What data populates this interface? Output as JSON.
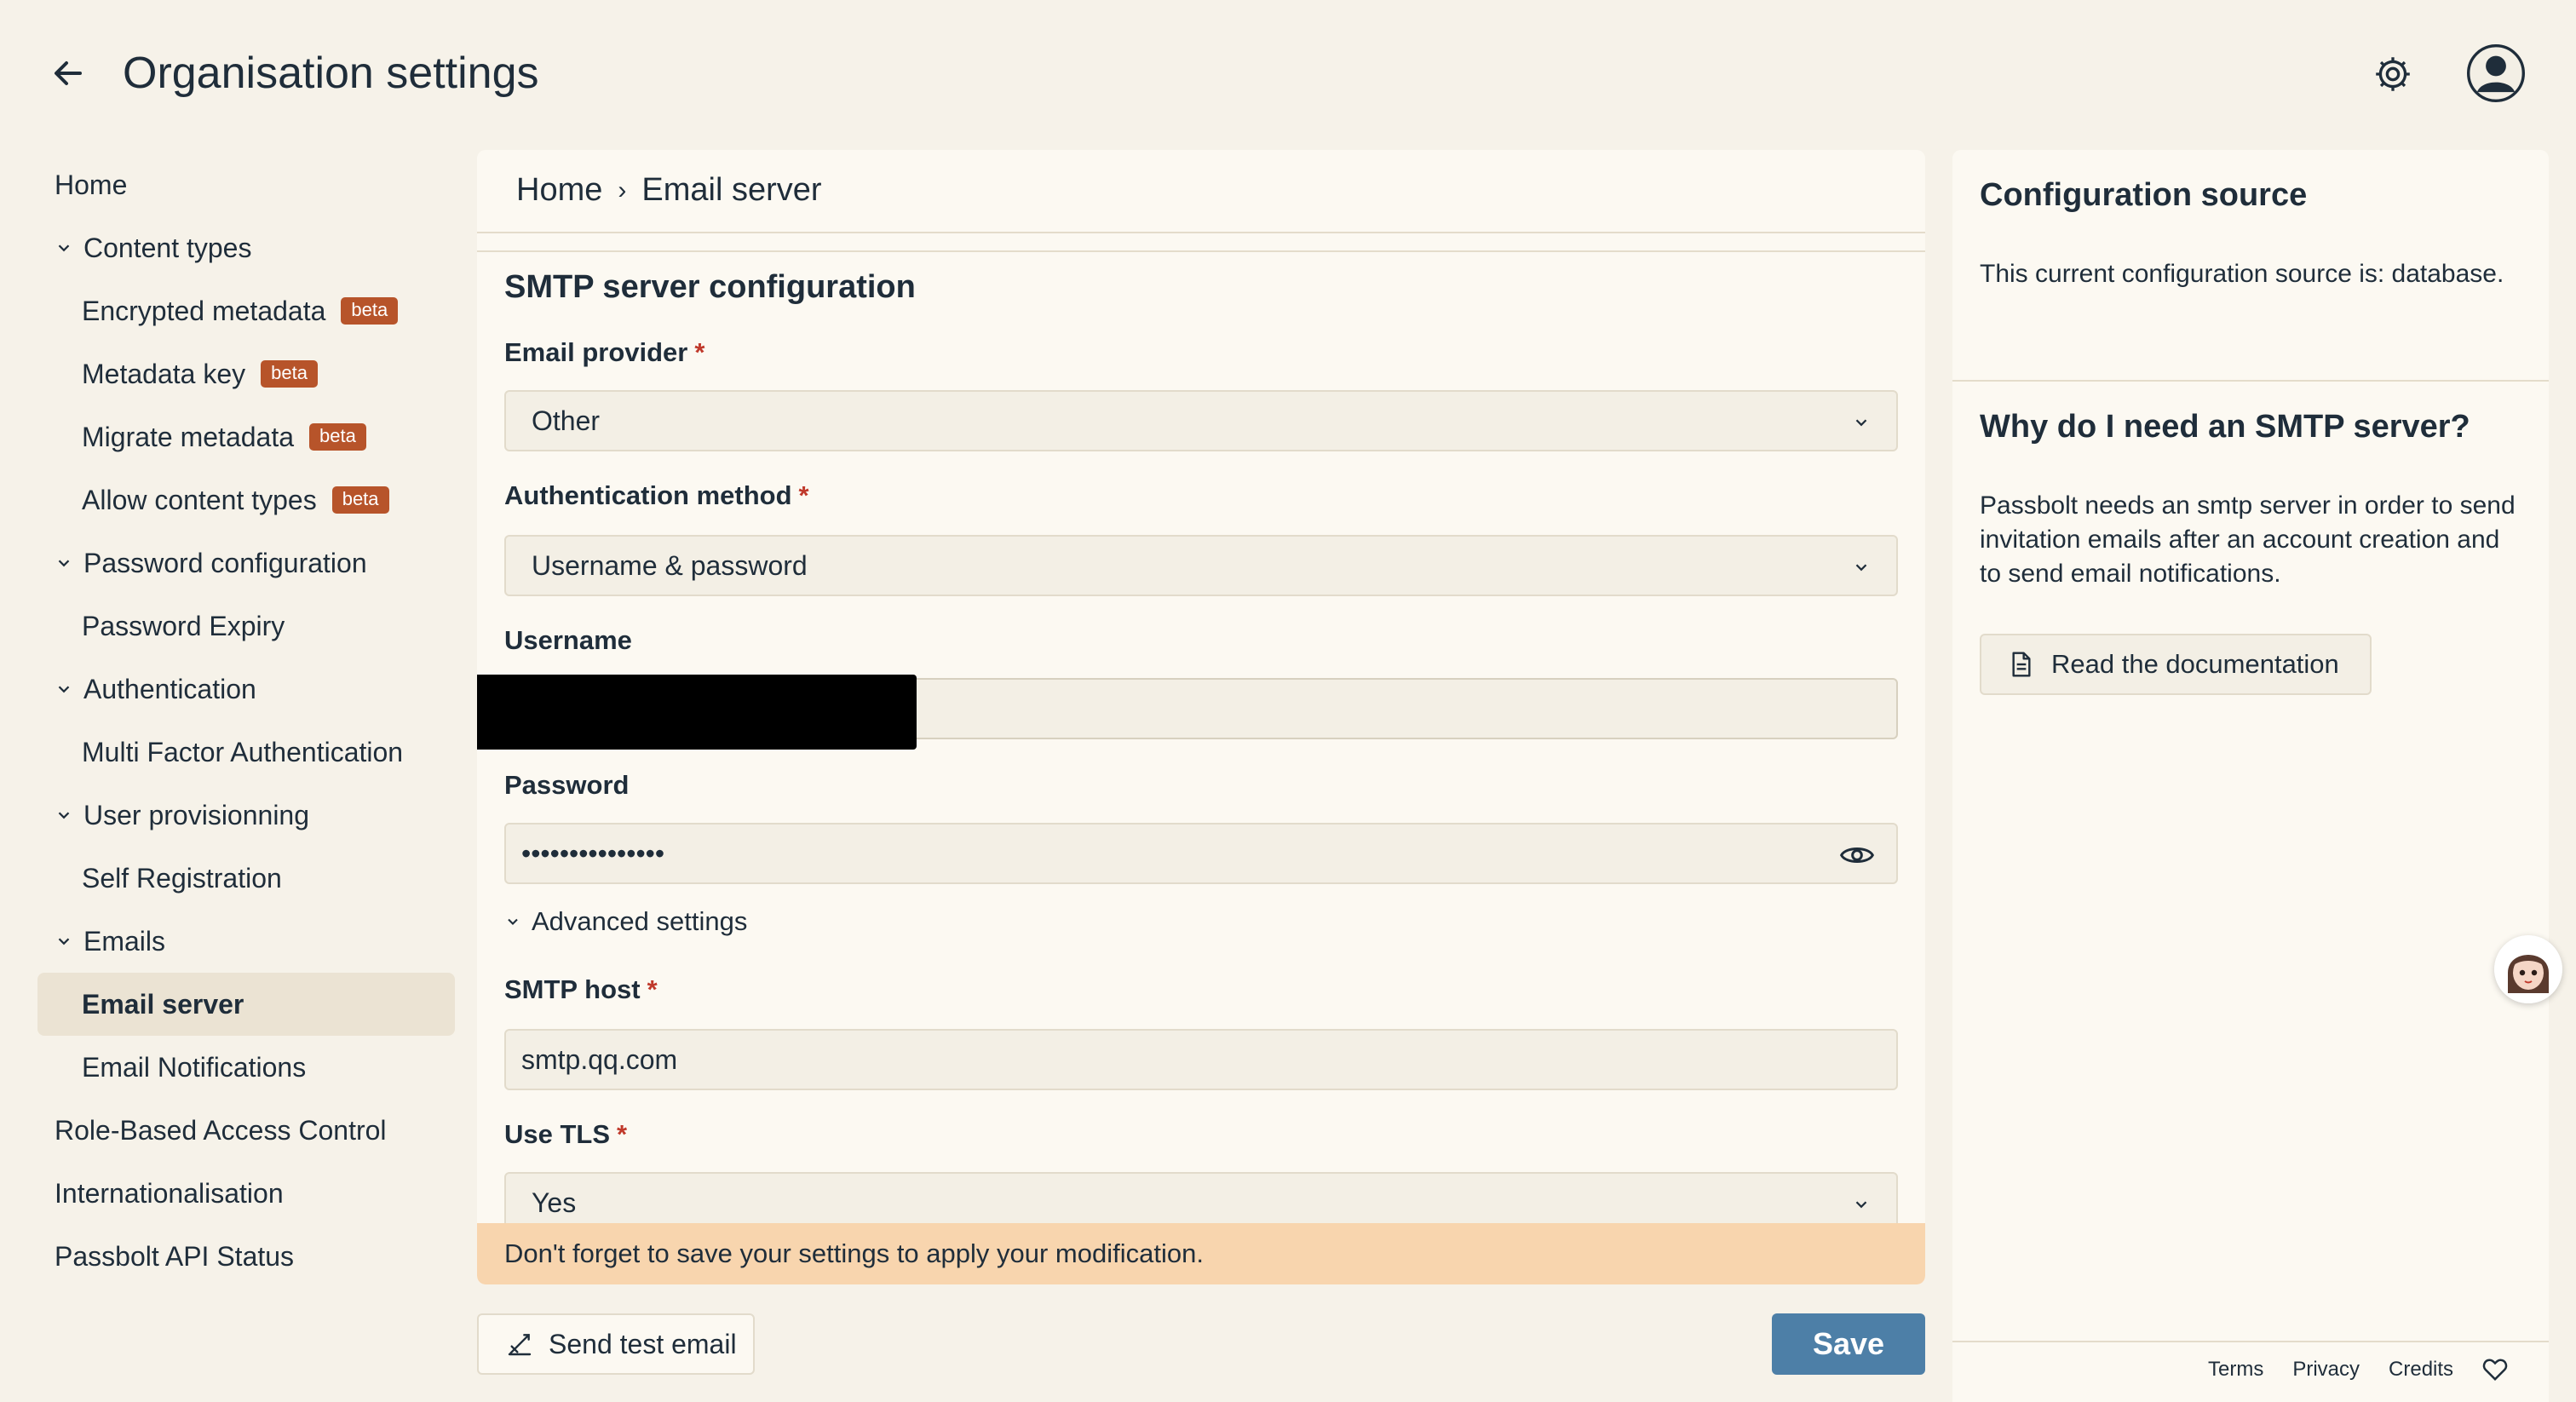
{
  "header": {
    "title": "Organisation settings"
  },
  "sidebar": {
    "items": [
      {
        "label": "Home"
      },
      {
        "label": "Content types"
      },
      {
        "label": "Encrypted metadata",
        "badge": "beta"
      },
      {
        "label": "Metadata key",
        "badge": "beta"
      },
      {
        "label": "Migrate metadata",
        "badge": "beta"
      },
      {
        "label": "Allow content types",
        "badge": "beta"
      },
      {
        "label": "Password configuration"
      },
      {
        "label": "Password Expiry"
      },
      {
        "label": "Authentication"
      },
      {
        "label": "Multi Factor Authentication"
      },
      {
        "label": "User provisionning"
      },
      {
        "label": "Self Registration"
      },
      {
        "label": "Emails"
      },
      {
        "label": "Email server"
      },
      {
        "label": "Email Notifications"
      },
      {
        "label": "Role-Based Access Control"
      },
      {
        "label": "Internationalisation"
      },
      {
        "label": "Passbolt API Status"
      }
    ]
  },
  "breadcrumb": {
    "home": "Home",
    "separator": "›",
    "current": "Email server"
  },
  "form": {
    "section_title": "SMTP server configuration",
    "required_mark": "*",
    "email_provider": {
      "label": "Email provider",
      "value": "Other"
    },
    "auth_method": {
      "label": "Authentication method",
      "value": "Username & password"
    },
    "username": {
      "label": "Username",
      "value": ""
    },
    "password": {
      "label": "Password",
      "value": "•••••••••••••••"
    },
    "advanced_label": "Advanced settings",
    "smtp_host": {
      "label": "SMTP host",
      "value": "smtp.qq.com"
    },
    "use_tls": {
      "label": "Use TLS",
      "value": "Yes"
    }
  },
  "warning": "Don't forget to save your settings to apply your modification.",
  "actions": {
    "send_test": "Send test email",
    "save": "Save"
  },
  "right_panel": {
    "config_title": "Configuration source",
    "config_text": "This current configuration source is: database.",
    "why_title": "Why do I need an SMTP server?",
    "why_text": "Passbolt needs an smtp server in order to send invitation emails after an account creation and to send email notifications.",
    "doc_button": "Read the documentation"
  },
  "footer": {
    "terms": "Terms",
    "privacy": "Privacy",
    "credits": "Credits"
  },
  "colors": {
    "background": "#f6f2e9",
    "card": "#fcf9f2",
    "badge": "#b7542a",
    "warning": "#f8d5ae",
    "primary": "#4d7fa7",
    "required": "#c0392b"
  }
}
